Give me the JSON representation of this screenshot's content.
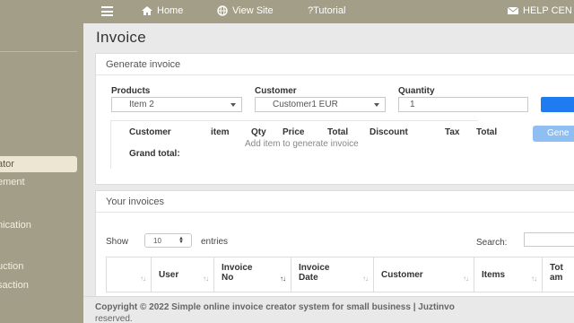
{
  "sidebar": {
    "items": [
      {
        "label": "ator",
        "active": true
      },
      {
        "label": "ement",
        "active": false
      },
      {
        "label": "nication",
        "active": false
      },
      {
        "label": "uction",
        "active": false
      },
      {
        "label": "saction",
        "active": false
      }
    ]
  },
  "topbar": {
    "home": "Home",
    "view_site": "View Site",
    "tutorial": "?Tutorial",
    "help": "HELP CEN"
  },
  "page": {
    "title": "Invoice"
  },
  "generate": {
    "header": "Generate invoice",
    "products_label": "Products",
    "products_value": "Item 2",
    "customer_label": "Customer",
    "customer_value": "Customer1 EUR",
    "quantity_label": "Quantity",
    "quantity_value": "1",
    "columns": [
      "Customer",
      "item",
      "Qty",
      "Price",
      "Total",
      "Discount",
      "Tax",
      "Total"
    ],
    "empty_text": "Add item to generate invoice",
    "grand_total": "Grand total:",
    "generate_button": "Gene"
  },
  "invoices": {
    "header": "Your invoices",
    "show": "Show",
    "entries_value": "10",
    "entries": "entries",
    "search": "Search:",
    "columns": [
      "",
      "User",
      "Invoice No",
      "Invoice Date",
      "Customer",
      "Items",
      "Tot am"
    ]
  },
  "footer": {
    "copyright": "Copyright © 2022 Simple online invoice creator system for small business | Juztinvo",
    "reserved": "reserved."
  },
  "colors": {
    "sidebar": "#a39e87",
    "accent": "#1e7cf0"
  }
}
